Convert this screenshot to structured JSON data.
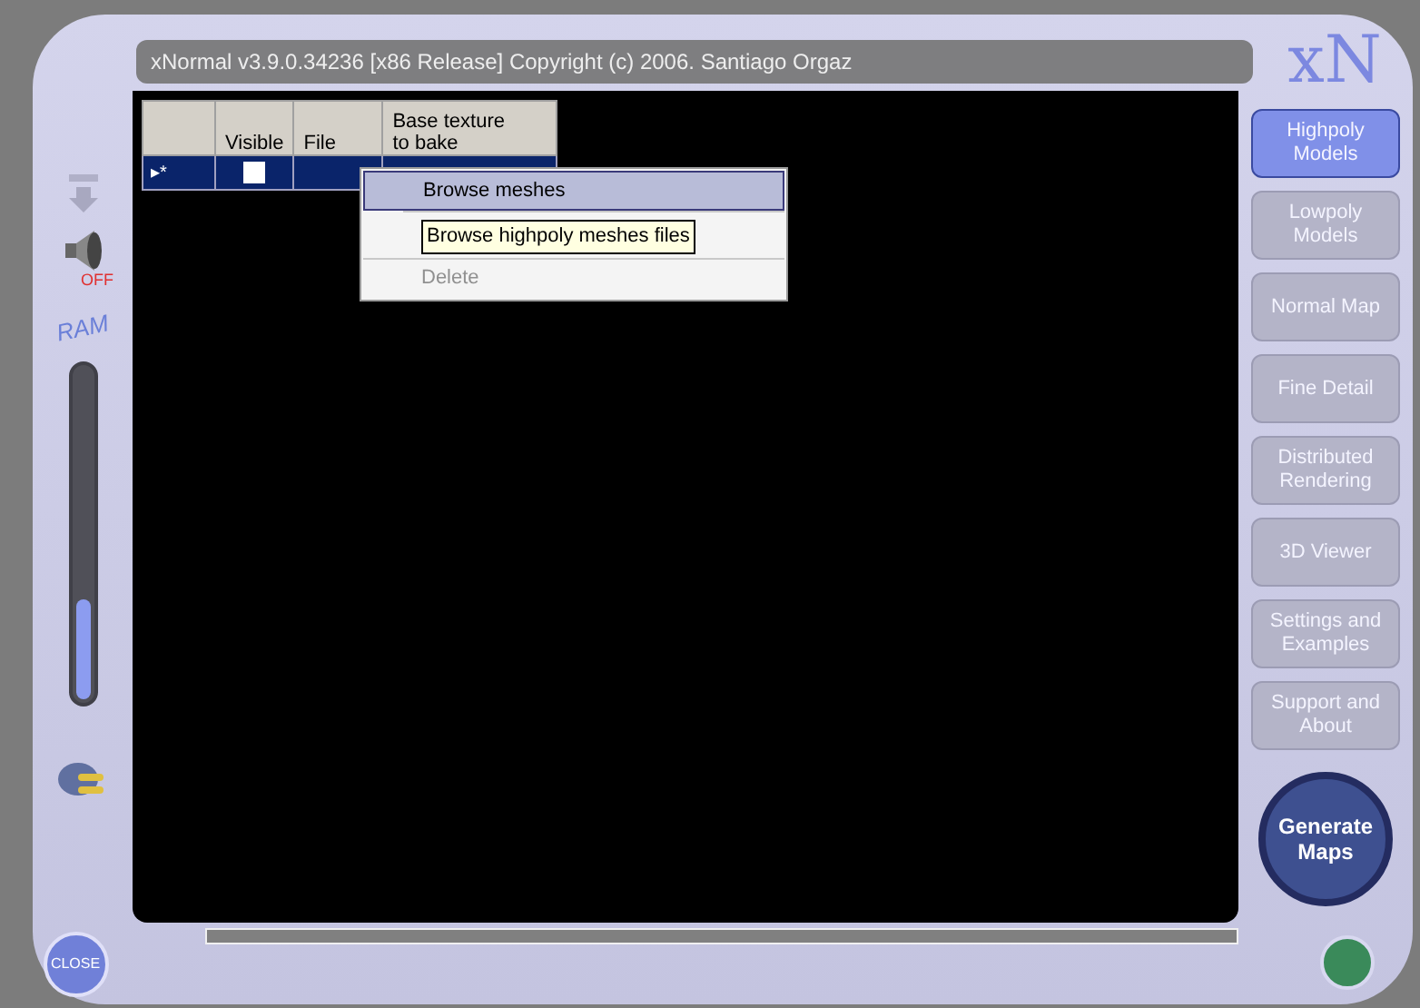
{
  "window": {
    "title": "xNormal v3.9.0.34236 [x86 Release] Copyright (c) 2006. Santiago Orgaz",
    "logo": "xN"
  },
  "left_panel": {
    "sound_label": "OFF",
    "ram_label": "RAM",
    "ram": {
      "level": 0.3
    }
  },
  "table": {
    "columns": [
      "",
      "Visible",
      "File",
      "Base texture\nto bake"
    ],
    "rows": [
      {
        "marker": "▸*",
        "visible": false,
        "selected": true
      }
    ]
  },
  "context_menu": {
    "items": [
      {
        "label": "Browse meshes",
        "disabled": false,
        "selected": true
      },
      {
        "kind": "covered"
      },
      {
        "label": "Delete",
        "disabled": true,
        "selected": false
      }
    ],
    "tooltip": "Browse highpoly meshes files"
  },
  "nav": [
    {
      "label": "Highpoly\nModels",
      "selected": true
    },
    {
      "label": "Lowpoly\nModels",
      "selected": false
    },
    {
      "label": "Normal Map",
      "selected": false
    },
    {
      "label": "Fine Detail",
      "selected": false
    },
    {
      "label": "Distributed\nRendering",
      "selected": false
    },
    {
      "label": "3D Viewer",
      "selected": false
    },
    {
      "label": "Settings and\nExamples",
      "selected": false
    },
    {
      "label": "Support and\nAbout",
      "selected": false
    }
  ],
  "progress": {
    "level": 0
  },
  "generate_button": "Generate\nMaps",
  "close_button": "CLOSE"
}
